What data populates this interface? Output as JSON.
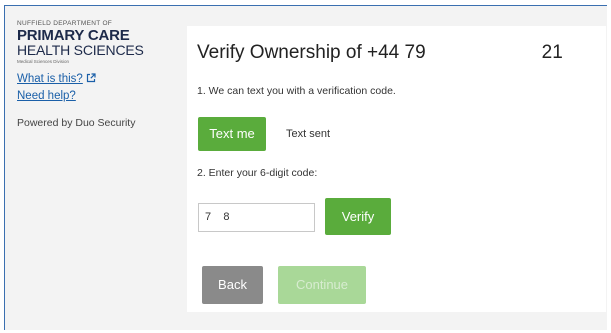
{
  "sidebar": {
    "logo": {
      "top": "NUFFIELD DEPARTMENT OF",
      "main": "PRIMARY CARE",
      "sub": "HEALTH SCIENCES",
      "tiny": "Medical Sciences Division"
    },
    "what_is_this": "What is this?",
    "external_link_icon": "external-link-icon",
    "need_help": "Need help?",
    "powered_by": "Powered by Duo Security"
  },
  "main": {
    "title_prefix": "Verify Ownership of +44 79",
    "title_suffix": "21",
    "step1": "1. We can text you with a verification code.",
    "text_me_label": "Text me",
    "text_sent": "Text sent",
    "step2": "2. Enter your 6-digit code:",
    "code_value": "7    8",
    "verify_label": "Verify",
    "back_label": "Back",
    "continue_label": "Continue"
  },
  "colors": {
    "green": "#5aac3c",
    "green_disabled": "#a9d898",
    "gray_button": "#8a8a8a",
    "link": "#1a5fa8"
  }
}
